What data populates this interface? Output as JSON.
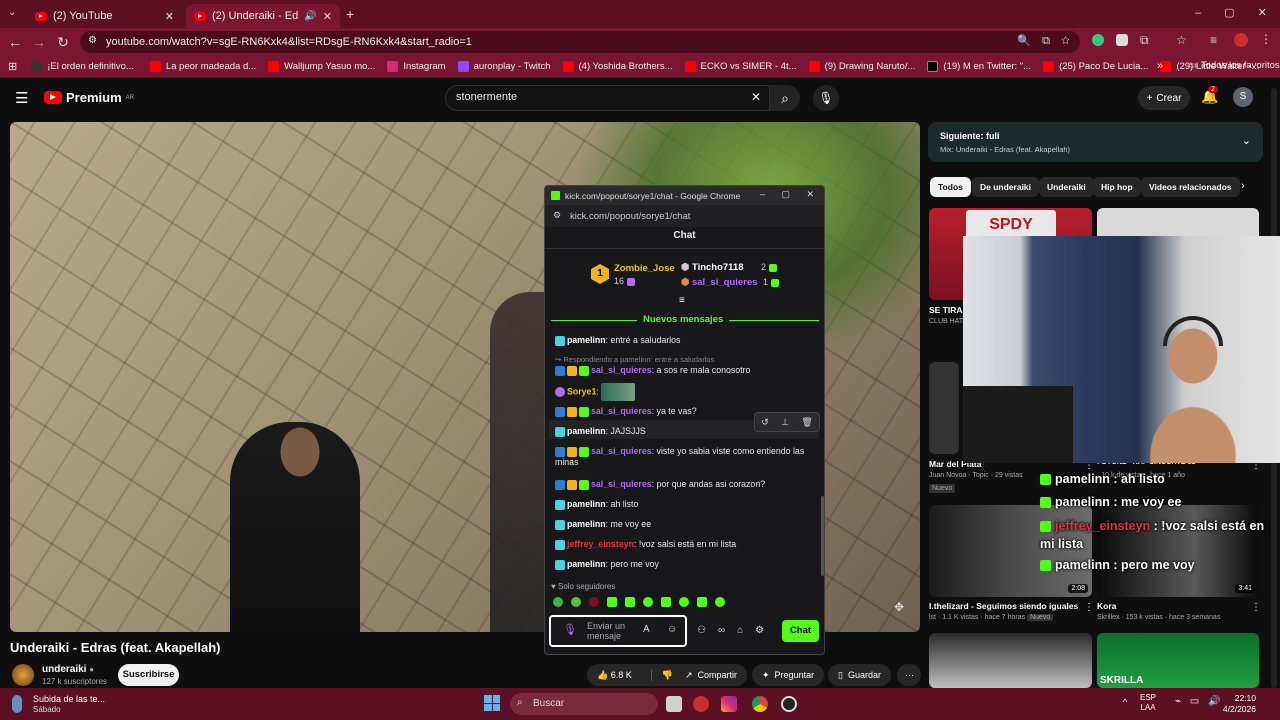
{
  "browser": {
    "tabs": [
      {
        "title": "(2) YouTube",
        "active": false
      },
      {
        "title": "(2) Underaiki - Edras (feat.",
        "active": true
      }
    ],
    "url": "youtube.com/watch?v=sgE-RN6Kxk4&list=RDsgE-RN6Kxk4&start_radio=1",
    "bookmarks": [
      {
        "label": "¡El orden definitivo...",
        "color": "#222222"
      },
      {
        "label": "La peor madeada d...",
        "color": "#ff0000"
      },
      {
        "label": "Walljump Yasuo mo...",
        "color": "#ff0000"
      },
      {
        "label": "Instagram",
        "color": "#d62976"
      },
      {
        "label": "auronplay - Twitch",
        "color": "#9146ff"
      },
      {
        "label": "(4) Yoshida Brothers...",
        "color": "#ff0000"
      },
      {
        "label": "ECKO vs SIMER - 4t...",
        "color": "#ff0000"
      },
      {
        "label": "(9) Drawing Naruto/...",
        "color": "#ff0000"
      },
      {
        "label": "(19) M en Twitter: \"...",
        "color": "#000000"
      },
      {
        "label": "(25) Paco De Lucia...",
        "color": "#ff0000"
      },
      {
        "label": "(29) Little Walter -...",
        "color": "#ff0000"
      }
    ],
    "bookmarks_folder": "Todos los favoritos"
  },
  "youtube": {
    "logo_text": "Premium",
    "region": "AR",
    "search_value": "stonermente",
    "create_label": "Crear",
    "notif_count": "2",
    "avatar_letter": "S",
    "video_title": "Underaiki - Edras (feat. Akapellah)",
    "channel_name": "underaiki",
    "subscribers": "127 k suscriptores",
    "subscribe_label": "Suscribirse",
    "likes": "6.8 K",
    "share_label": "Compartir",
    "ask_label": "Preguntar",
    "save_label": "Guardar",
    "up_next_label": "Siguiente: fuli",
    "mix_label": "Mix: Underaiki - Edras (feat. Akapellah)",
    "chips": [
      "Todos",
      "De underaiki",
      "Underaiki",
      "Hip hop",
      "Videos relacionados"
    ],
    "side_videos": [
      {
        "title": "SE TIRAR",
        "meta": "CLUB HAT"
      },
      {
        "title": "Mar del Plata",
        "meta1": "Juan Novoa - Topic · 29 vistas",
        "badge": "Nuevo"
      },
      {
        "title": "FOYONE - RAP SINCORTE 31",
        "meta1": "· 10 k de vistas · hace 1 año"
      },
      {
        "title": "I.thelizard - Seguimos siendo iguales",
        "meta1": "lst · 1.1 K vistas · hace 7 horas",
        "badge": "Nuevo",
        "duration": "2:08"
      },
      {
        "title": "Kora",
        "meta1": "Skrillex · 153 k vistas · hace 3 semanas",
        "duration": "3:41"
      },
      {
        "title": "SKRILLA",
        "meta1": ""
      }
    ],
    "thumb_texts": {
      "spdy": "SPDY"
    }
  },
  "webcam_overlay": [
    {
      "user": "pamelinn",
      "text": " : ah listo",
      "color": "#ffffff"
    },
    {
      "user": "pamelinn",
      "text": " : me voy ee",
      "color": "#ffffff"
    },
    {
      "user": "jeffrey_einsteyn",
      "text": " : !voz salsi está en mi lista",
      "color": "#e0304a"
    },
    {
      "user": "pamelinn",
      "text": " : pero me voy",
      "color": "#ffffff"
    }
  ],
  "kick": {
    "window_title": "kick.com/popout/sorye1/chat - Google Chrome",
    "url": "kick.com/popout/sorye1/chat",
    "header": "Chat",
    "top_gifter": {
      "rank": "1",
      "name": "Zombie_Jose",
      "count": "16"
    },
    "gifter2": {
      "name": "Tincho7118",
      "count": "2"
    },
    "gifter3": {
      "name": "sal_si_quieres",
      "count": "1"
    },
    "new_messages_label": "Nuevos mensajes",
    "messages": [
      {
        "user": "pamelinn",
        "text": ": entré a saludarlos",
        "ucls": "u-white",
        "badges": [
          "b-cyan"
        ]
      },
      {
        "reply": "Respondiendo a pamelinn: entré a saludarlos"
      },
      {
        "user": "sal_si_quieres",
        "text": ": a sos re mala conosotro",
        "ucls": "u-purple",
        "badges": [
          "b-blue",
          "b-crown",
          "b-green"
        ]
      },
      {
        "user": "Sorye1",
        "text": ":",
        "ucls": "u-yellow",
        "badges": [
          "b-purplemic"
        ]
      },
      {
        "user": "sal_si_quieres",
        "text": ": ya te vas?",
        "ucls": "u-purple",
        "badges": [
          "b-blue",
          "b-crown",
          "b-green"
        ]
      },
      {
        "user": "pamelinn",
        "text": ": JAJSJJS",
        "ucls": "u-white",
        "badges": [
          "b-cyan"
        ]
      },
      {
        "user": "sal_si_quieres",
        "text": ": viste yo sabia viste como entiendo las minas",
        "ucls": "u-purple",
        "badges": [
          "b-blue",
          "b-crown",
          "b-green"
        ]
      },
      {
        "user": "sal_si_quieres",
        "text": ": por que andas asi corazon?",
        "ucls": "u-purple",
        "badges": [
          "b-blue",
          "b-crown",
          "b-green"
        ]
      },
      {
        "user": "pamelinn",
        "text": ": ah listo",
        "ucls": "u-white",
        "badges": [
          "b-cyan"
        ]
      },
      {
        "user": "pamelinn",
        "text": ": me voy ee",
        "ucls": "u-white",
        "badges": [
          "b-cyan"
        ]
      },
      {
        "user": "jeffrey_einsteyn",
        "text": ": !voz salsi está en mi lista",
        "ucls": "u-red",
        "badges": [
          "b-cyan"
        ]
      },
      {
        "user": "pamelinn",
        "text": ": pero me voy",
        "ucls": "u-white",
        "badges": [
          "b-cyan"
        ]
      }
    ],
    "followers_only": "Solo seguidores",
    "input_placeholder": "Enviar un mensaje",
    "chat_button": "Chat"
  },
  "taskbar": {
    "notification_title": "Subida de las te...",
    "notification_sub": "Sábado",
    "search_label": "Buscar",
    "lang": "ESP",
    "lang2": "LAA",
    "time": "22:10",
    "date": "4/2/2026"
  }
}
